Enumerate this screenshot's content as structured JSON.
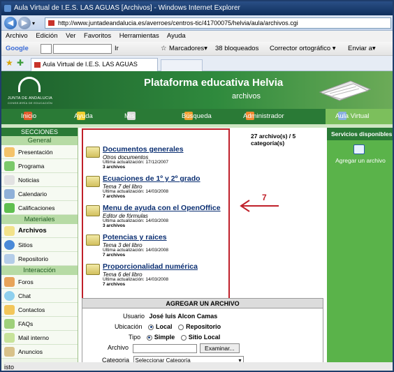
{
  "window": {
    "title": "Aula Virtual de I.E.S. LAS AGUAS [Archivos] - Windows Internet Explorer"
  },
  "address": {
    "url": "http://www.juntadeandalucia.es/averroes/centros-tic/41700075/helvia/aula/archivos.cgi"
  },
  "menu": [
    "Archivo",
    "Edición",
    "Ver",
    "Favoritos",
    "Herramientas",
    "Ayuda"
  ],
  "toolbar": {
    "google": "Google",
    "go": "Ir",
    "marcadores": "Marcadores▾",
    "bloqueados": "38 bloqueados",
    "corrector": "Corrector ortográfico ▾",
    "enviar": "Enviar a▾"
  },
  "tab": {
    "label": "Aula Virtual de I.E.S. LAS AGUAS [Archivos]"
  },
  "banner": {
    "logo_text": "JUNTA DE ANDALUCIA",
    "logo_sub": "CONSEJERÍA DE EDUCACIÓN",
    "title": "Plataforma educativa Helvia",
    "subtitle": "archivos"
  },
  "nav": {
    "inicio": "Inicio",
    "ayuda": "Ayuda",
    "misdatos": "Mis datos",
    "busqueda": "Búsqueda",
    "administrador": "Administrador",
    "aula": "Aula Virtual"
  },
  "sidebar": {
    "header": "SECCIONES",
    "general": "General",
    "general_items": [
      "Presentación",
      "Programa",
      "Noticias",
      "Calendario",
      "Calificaciones"
    ],
    "materiales": "Materiales",
    "materiales_items": [
      "Archivos",
      "Sitios",
      "Repositorio"
    ],
    "interaccion": "Interacción",
    "interaccion_items": [
      "Foros",
      "Chat",
      "Contactos",
      "FAQs",
      "Mail interno",
      "Anuncios"
    ]
  },
  "content": {
    "count": "27 archivo(s) / 5 categoría(s)",
    "folders": [
      {
        "name": "Documentos generales",
        "desc": "Otros documentos",
        "updated": "Ultima actualización: 17/12/2007",
        "count": "3 archivos"
      },
      {
        "name": "Ecuaciones de 1º y 2º grado",
        "desc": "Tema 7 del libro",
        "updated": "Ultima actualización: 14/03/2008",
        "count": "7 archivos"
      },
      {
        "name": "Menu de ayuda con el OpenOffice",
        "desc": "Editor de fórmulas",
        "updated": "Ultima actualización: 14/03/2008",
        "count": "3 archivos"
      },
      {
        "name": "Potencias y raices",
        "desc": "Tema 3 del libro",
        "updated": "Ultima actualización: 14/03/2008",
        "count": "7 archivos"
      },
      {
        "name": "Proporcionalidad numérica",
        "desc": "Tema 6 del libro",
        "updated": "Ultima actualización: 14/03/2008",
        "count": "7 archivos"
      }
    ],
    "annotation": "7"
  },
  "form": {
    "header": "AGREGAR UN ARCHIVO",
    "usuario_label": "Usuario",
    "usuario_value": "José luis Alcon Camas",
    "ubicacion_label": "Ubicación",
    "local": "Local",
    "repositorio": "Repositorio",
    "tipo_label": "Tipo",
    "simple": "Simple",
    "sitio_local": "Sitio Local",
    "archivo_label": "Archivo",
    "examinar": "Examinar...",
    "categoria_label": "Categoria",
    "categoria_value": "Seleccionar Categoría"
  },
  "right": {
    "header": "Servicios disponibles",
    "add": "Agregar un archivo"
  },
  "status": {
    "text": "isto"
  },
  "colors": {
    "dark_green": "#2a7a36",
    "light_green": "#5ab34a",
    "annotation_red": "#c0202a",
    "link_blue": "#0b2f72"
  }
}
